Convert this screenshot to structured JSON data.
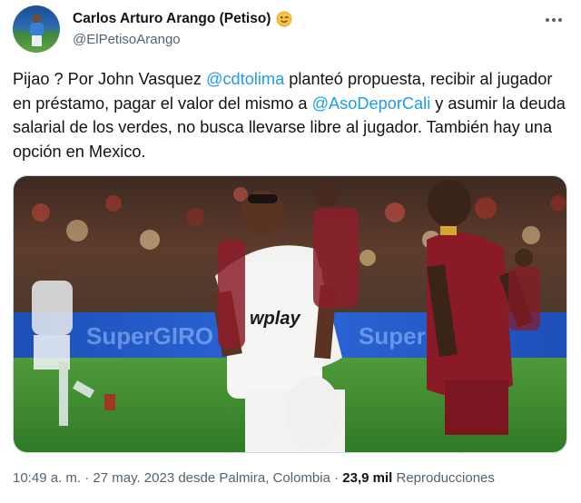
{
  "author": {
    "display_name": "Carlos Arturo Arango (Petiso)",
    "handle": "@ElPetisoArango",
    "avatar_icon": "avatar-photo",
    "name_emoji_icon": "winking-face-emoji"
  },
  "tweet": {
    "segments": [
      {
        "text": "Pijao ? Por John Vasquez ",
        "type": "text"
      },
      {
        "text": "@cdtolima",
        "type": "mention"
      },
      {
        "text": " planteó propuesta, recibir al jugador en préstamo, pagar el valor del mismo a ",
        "type": "text"
      },
      {
        "text": "@AsoDeporCali",
        "type": "mention"
      },
      {
        "text": " y asumir la deuda salarial de los verdes, no busca llevarse libre al jugador. También hay una opción en Mexico.",
        "type": "text"
      }
    ],
    "photo": {
      "jersey_sponsor": "wplay",
      "ad_board_text": "SuperGIRO"
    }
  },
  "meta": {
    "time": "10:49 a. m.",
    "separator": "·",
    "date": "27 may. 2023",
    "location_text": "desde Palmira, Colombia",
    "views": "23,9 mil",
    "views_label": "Reproducciones"
  },
  "colors": {
    "text": "#0f1419",
    "secondary": "#536471",
    "link": "#1d9bf0",
    "border": "#cfd9de"
  }
}
